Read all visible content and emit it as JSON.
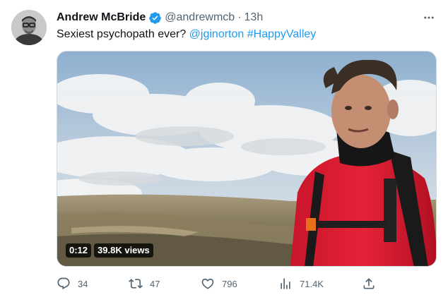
{
  "tweet": {
    "display_name": "Andrew McBride",
    "handle": "@andrewmcb",
    "separator": "·",
    "time": "13h",
    "text_plain": "Sexiest psychopath ever? ",
    "mention": "@jginorton",
    "hashtag": "#HappyValley",
    "verified_icon": "verified-badge-icon",
    "more_icon": "more-icon"
  },
  "media": {
    "duration": "0:12",
    "views": "39.8K views"
  },
  "actions": {
    "replies": "34",
    "retweets": "47",
    "likes": "796",
    "views": "71.4K"
  },
  "colors": {
    "accent": "#1d9bf0",
    "secondary_text": "#536471",
    "primary_text": "#0f1419"
  }
}
